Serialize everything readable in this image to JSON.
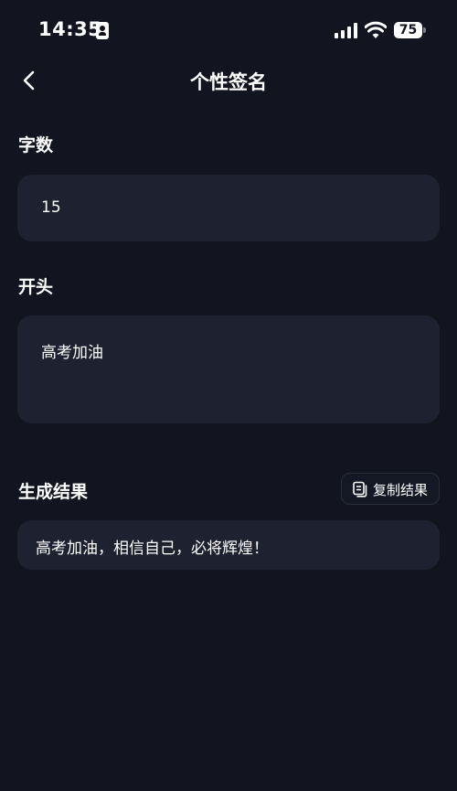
{
  "status_bar": {
    "time": "14:35",
    "battery": "75",
    "icons": [
      "id-card-icon",
      "signal-icon",
      "wifi-icon",
      "battery-icon"
    ]
  },
  "nav": {
    "back_icon": "chevron-left-icon",
    "title": "个性签名"
  },
  "word_count": {
    "label": "字数",
    "value": "15"
  },
  "opening": {
    "label": "开头",
    "value": "高考加油"
  },
  "result": {
    "label": "生成结果",
    "copy_label": "复制结果",
    "copy_icon": "copy-icon",
    "text": "高考加油，相信自己，必将辉煌！"
  },
  "colors": {
    "background": "#12151f",
    "card": "#1e2130",
    "text": "#ffffff"
  }
}
